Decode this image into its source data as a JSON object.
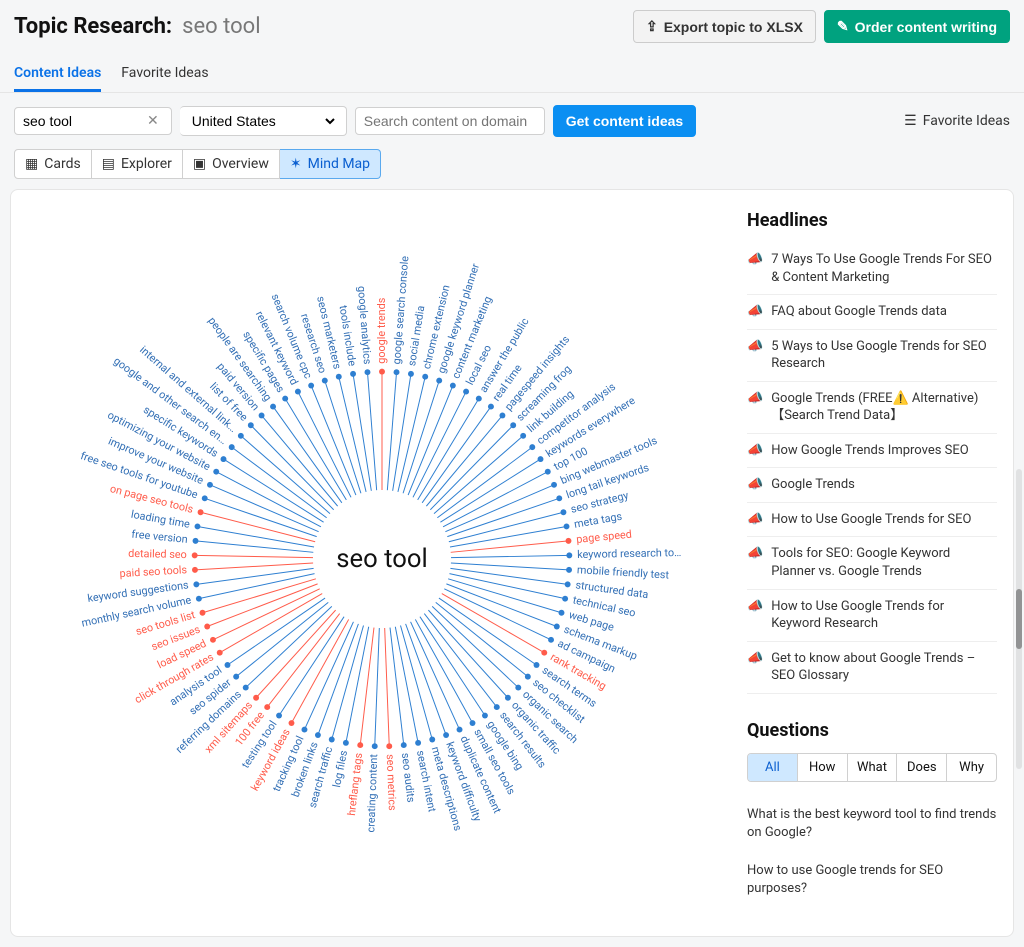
{
  "header": {
    "title_label": "Topic Research:",
    "query": "seo tool",
    "export_label": "Export topic to XLSX",
    "order_label": "Order content writing"
  },
  "tabs": {
    "content_ideas": "Content Ideas",
    "favorite_ideas": "Favorite Ideas",
    "active": "content_ideas"
  },
  "controls": {
    "query_value": "seo tool",
    "country_value": "United States",
    "domain_placeholder": "Search content on domain",
    "get_ideas_label": "Get content ideas",
    "favorite_link": "Favorite Ideas"
  },
  "views": {
    "cards": "Cards",
    "explorer": "Explorer",
    "overview": "Overview",
    "mindmap": "Mind Map",
    "active": "mindmap"
  },
  "mindmap": {
    "center": "seo tool",
    "spokes": [
      {
        "label": "google trends",
        "red": true
      },
      {
        "label": "google search console",
        "red": false
      },
      {
        "label": "social media",
        "red": false
      },
      {
        "label": "chrome extension",
        "red": false
      },
      {
        "label": "google keyword planner",
        "red": false
      },
      {
        "label": "content marketing",
        "red": false
      },
      {
        "label": "local seo",
        "red": false
      },
      {
        "label": "answer the public",
        "red": false
      },
      {
        "label": "real time",
        "red": false
      },
      {
        "label": "pagespeed insights",
        "red": false
      },
      {
        "label": "screaming frog",
        "red": false
      },
      {
        "label": "link building",
        "red": false
      },
      {
        "label": "competitor analysis",
        "red": false
      },
      {
        "label": "keywords everywhere",
        "red": false
      },
      {
        "label": "top 100",
        "red": false
      },
      {
        "label": "bing webmaster tools",
        "red": false
      },
      {
        "label": "long tail keywords",
        "red": false
      },
      {
        "label": "seo strategy",
        "red": false
      },
      {
        "label": "meta tags",
        "red": false
      },
      {
        "label": "page speed",
        "red": true
      },
      {
        "label": "keyword research to…",
        "red": false
      },
      {
        "label": "mobile friendly test",
        "red": false
      },
      {
        "label": "structured data",
        "red": false
      },
      {
        "label": "technical seo",
        "red": false
      },
      {
        "label": "web page",
        "red": false
      },
      {
        "label": "schema markup",
        "red": false
      },
      {
        "label": "ad campaign",
        "red": false
      },
      {
        "label": "rank tracking",
        "red": true
      },
      {
        "label": "search terms",
        "red": false
      },
      {
        "label": "seo checklist",
        "red": false
      },
      {
        "label": "organic search",
        "red": false
      },
      {
        "label": "organic traffic",
        "red": false
      },
      {
        "label": "search results",
        "red": false
      },
      {
        "label": "google bing",
        "red": false
      },
      {
        "label": "small seo tools",
        "red": false
      },
      {
        "label": "duplicate content",
        "red": false
      },
      {
        "label": "keyword difficulty",
        "red": false
      },
      {
        "label": "meta descriptions",
        "red": false
      },
      {
        "label": "search intent",
        "red": false
      },
      {
        "label": "seo audits",
        "red": false
      },
      {
        "label": "seo metrics",
        "red": true
      },
      {
        "label": "creating content",
        "red": false
      },
      {
        "label": "hreflang tags",
        "red": true
      },
      {
        "label": "log files",
        "red": false
      },
      {
        "label": "search traffic",
        "red": false
      },
      {
        "label": "broken links",
        "red": false
      },
      {
        "label": "tracking tool",
        "red": false
      },
      {
        "label": "keyword ideas",
        "red": true
      },
      {
        "label": "testing tool",
        "red": false
      },
      {
        "label": "100 free",
        "red": true
      },
      {
        "label": "xml sitemaps",
        "red": true
      },
      {
        "label": "referring domains",
        "red": false
      },
      {
        "label": "seo spider",
        "red": false
      },
      {
        "label": "analysis tool",
        "red": false
      },
      {
        "label": "click through rates",
        "red": true
      },
      {
        "label": "load speed",
        "red": true
      },
      {
        "label": "seo issues",
        "red": true
      },
      {
        "label": "seo tools list",
        "red": true
      },
      {
        "label": "monthly search volume",
        "red": false
      },
      {
        "label": "keyword suggestions",
        "red": false
      },
      {
        "label": "paid seo tools",
        "red": true
      },
      {
        "label": "detailed seo",
        "red": true
      },
      {
        "label": "free version",
        "red": false
      },
      {
        "label": "loading time",
        "red": false
      },
      {
        "label": "on page seo tools",
        "red": true
      },
      {
        "label": "free seo tools for youtube",
        "red": false
      },
      {
        "label": "improve your website",
        "red": false
      },
      {
        "label": "optimizing your website",
        "red": false
      },
      {
        "label": "specific keywords",
        "red": false
      },
      {
        "label": "google and other search en…",
        "red": false
      },
      {
        "label": "internal and external link…",
        "red": false
      },
      {
        "label": "list of free",
        "red": false
      },
      {
        "label": "paid version",
        "red": false
      },
      {
        "label": "people are searching",
        "red": false
      },
      {
        "label": "specific pages",
        "red": false
      },
      {
        "label": "relevant keyword",
        "red": false
      },
      {
        "label": "search volume cpc",
        "red": false
      },
      {
        "label": "research seo",
        "red": false
      },
      {
        "label": "seos marketers",
        "red": false
      },
      {
        "label": "tools include",
        "red": false
      },
      {
        "label": "google analytics",
        "red": false
      }
    ]
  },
  "sidebar": {
    "headlines_title": "Headlines",
    "headlines": [
      {
        "text": "7 Ways To Use Google Trends For SEO & Content Marketing",
        "highlighted": true
      },
      {
        "text": "FAQ about Google Trends data",
        "highlighted": true
      },
      {
        "text": "5 Ways to Use Google Trends for SEO Research",
        "highlighted": true
      },
      {
        "text": "Google Trends (FREE⚠️ Alternative)【Search Trend Data】",
        "highlighted": true
      },
      {
        "text": "How Google Trends Improves SEO",
        "highlighted": true
      },
      {
        "text": "Google Trends",
        "highlighted": false
      },
      {
        "text": "How to Use Google Trends for SEO",
        "highlighted": false
      },
      {
        "text": "Tools for SEO: Google Keyword Planner vs. Google Trends",
        "highlighted": false
      },
      {
        "text": "How to Use Google Trends for Keyword Research",
        "highlighted": false
      },
      {
        "text": "Get to know about Google Trends – SEO Glossary",
        "highlighted": false
      }
    ],
    "questions_title": "Questions",
    "question_tabs": [
      "All",
      "How",
      "What",
      "Does",
      "Why"
    ],
    "question_tab_active": "All",
    "questions": [
      "What is the best keyword tool to find trends on Google?",
      "How to use Google trends for SEO purposes?"
    ]
  }
}
